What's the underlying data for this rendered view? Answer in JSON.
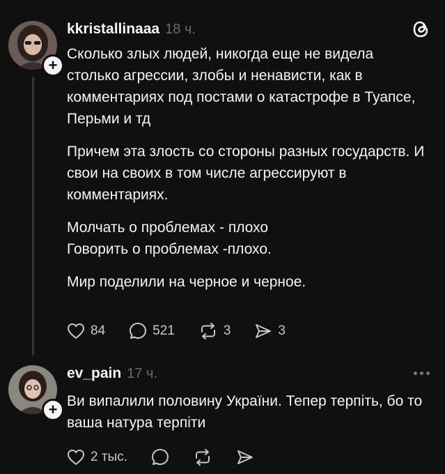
{
  "post1": {
    "username": "kkristallinaaa",
    "time": "18 ч.",
    "paragraphs": [
      "Сколько злых людей,  никогда еще не видела столько агрессии, злобы и ненависти, как в комментариях под постами о катастрофе в Туапсе, Перьми и тд",
      "Причем эта злость со стороны разных государств. И свои на своих в том числе агрессируют в комментариях.",
      "Молчать о проблемах - плохо\nГоворить о проблемах -плохо.",
      "Мир поделили на черное и черное."
    ],
    "likes": "84",
    "comments": "521",
    "reposts": "3",
    "shares": "3"
  },
  "post2": {
    "username": "ev_pain",
    "time": "17 ч.",
    "text": "Ви випалили половину України. Тепер терпіть, бо то ваша натура терпіти",
    "likes": "2 тыс."
  },
  "icons": {
    "like": "heart-icon",
    "comment": "comment-bubble-icon",
    "repost": "repost-icon",
    "share": "share-send-icon",
    "app": "threads-logo-icon",
    "more": "more-dots-icon"
  },
  "colors": {
    "background": "#101010",
    "text": "#f3f5f7",
    "muted": "#6b6b6b"
  }
}
